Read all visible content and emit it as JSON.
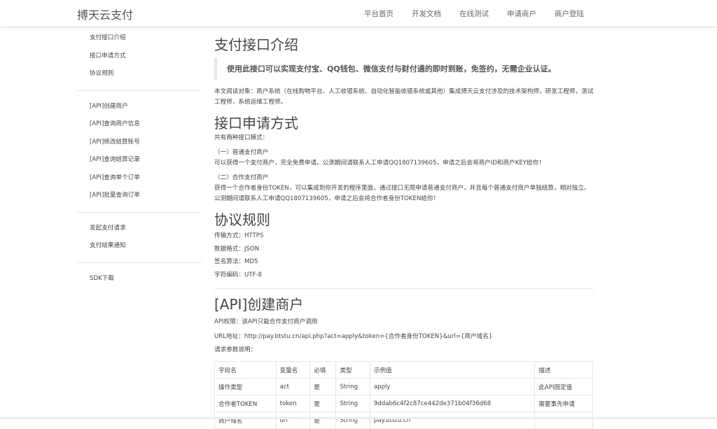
{
  "header": {
    "brand": "搏天云支付",
    "nav": [
      "平台首页",
      "开发文档",
      "在线测试",
      "申请商户",
      "商户登陆"
    ]
  },
  "sidebar": {
    "group1": [
      "支付接口介绍",
      "接口申请方式",
      "协议规则"
    ],
    "group2": [
      "[API]创建商户",
      "[API]查询商户信息",
      "[API]修改结算账号",
      "[API]查询结算记录",
      "[API]查询单个订单",
      "[API]批量查询订单"
    ],
    "group3": [
      "发起支付请求",
      "支付结果通知"
    ],
    "group4": [
      "SDK下载"
    ]
  },
  "intro": {
    "title": "支付接口介绍",
    "quote": "使用此接口可以实现支付宝、QQ钱包、微信支付与财付通的即时到账，免签约，无需企业认证。",
    "desc": "本文阅读对象：商户系统（在线购物平台、人工收银系统、自动化智能收银系统或其他）集成搏天云支付涉及的技术架构师，研发工程师，测试工程师，系统运维工程师。"
  },
  "apply": {
    "title": "接口申请方式",
    "lead": "共有两种接口模式：",
    "mode1_title": "（一）普通支付商户",
    "mode1_desc": "可以获得一个支付商户，完全免费申请。公测期间请联系人工申请QQ1807139605，申请之后会将商户ID和商户KEY给你！",
    "mode2_title": "（二）合作支付商户",
    "mode2_desc": "获得一个合作者身份TOKEN，可以集成到你开发的程序里面，通过接口无限申请普通支付商户，并且每个普通支付商户单独结算，相对独立。公测期间请联系人工申请QQ1807139605，申请之后会将合作者身份TOKEN给你！"
  },
  "rules": {
    "title": "协议规则",
    "lines": [
      "传输方式：HTTPS",
      "数据格式：JSON",
      "签名算法：MD5",
      "字符编码：UTF-8"
    ]
  },
  "create": {
    "title": "[API]创建商户",
    "perm": "API权限：该API只能合作支付商户调用",
    "url": "URL地址：http://pay.btstu.cn/api.php?act=apply&token={合作者身份TOKEN}&url={商户域名}",
    "params_label": "请求参数说明：",
    "table": {
      "headers": [
        "字段名",
        "变量名",
        "必填",
        "类型",
        "示例值",
        "描述"
      ],
      "rows": [
        [
          "操作类型",
          "act",
          "是",
          "String",
          "apply",
          "此API固定值"
        ],
        [
          "合作者TOKEN",
          "token",
          "是",
          "String",
          "9ddab6c4f2c87ce442de371b04f36d68",
          "需要事先申请"
        ],
        [
          "商户域名",
          "url",
          "是",
          "String",
          "pay.btstu.cn",
          ""
        ]
      ]
    }
  }
}
